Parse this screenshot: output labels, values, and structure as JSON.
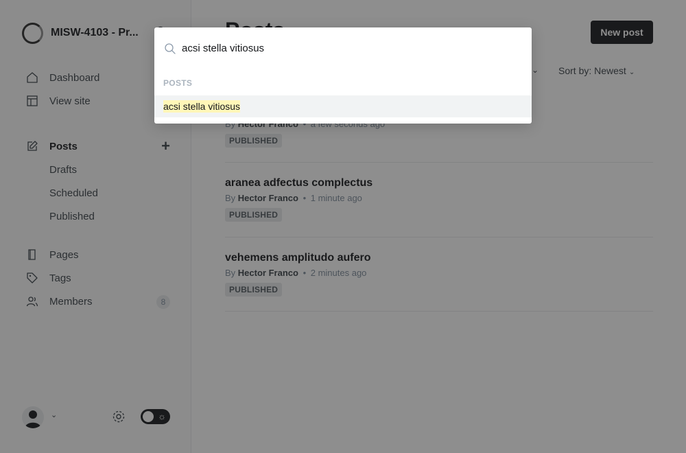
{
  "sidebar": {
    "site_title": "MISW-4103 - Pr...",
    "primary": [
      {
        "label": "Dashboard",
        "icon": "home-icon"
      },
      {
        "label": "View site",
        "icon": "layout-icon"
      }
    ],
    "posts": {
      "label": "Posts",
      "icon": "edit-icon",
      "sub": [
        {
          "label": "Drafts"
        },
        {
          "label": "Scheduled"
        },
        {
          "label": "Published"
        }
      ]
    },
    "secondary": [
      {
        "label": "Pages",
        "icon": "pages-icon"
      },
      {
        "label": "Tags",
        "icon": "tag-icon"
      },
      {
        "label": "Members",
        "icon": "members-icon",
        "badge": "8"
      }
    ]
  },
  "header": {
    "title": "Posts",
    "new_post_label": "New post",
    "sort_label": "Sort by: Newest"
  },
  "posts": [
    {
      "title": "acsi stella vitiosus",
      "by": "By",
      "author": "Hector Franco",
      "time": "a few seconds ago",
      "status": "PUBLISHED"
    },
    {
      "title": "aranea adfectus complectus",
      "by": "By",
      "author": "Hector Franco",
      "time": "1 minute ago",
      "status": "PUBLISHED"
    },
    {
      "title": "vehemens amplitudo aufero",
      "by": "By",
      "author": "Hector Franco",
      "time": "2 minutes ago",
      "status": "PUBLISHED"
    }
  ],
  "search": {
    "query": "acsi stella vitiosus",
    "section_label": "POSTS",
    "results": [
      {
        "label": "acsi stella vitiosus"
      }
    ]
  },
  "colors": {
    "accent_dark": "#15171a",
    "highlight": "#fff6b8",
    "overlay": "rgba(30,30,30,0.5)"
  }
}
